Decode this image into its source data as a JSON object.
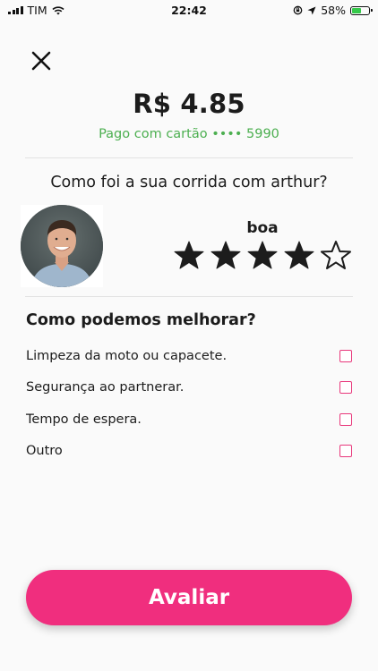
{
  "status_bar": {
    "carrier": "TIM",
    "time": "22:42",
    "battery": "58%",
    "battery_level": 0.58
  },
  "receipt": {
    "price": "R$ 4.85",
    "payment": "Pago com cartão •••• 5990"
  },
  "rating": {
    "question": "Como foi a sua corrida com arthur?",
    "label": "boa",
    "value": 4,
    "max": 5
  },
  "feedback": {
    "title": "Como podemos melhorar?",
    "options": [
      {
        "label": "Limpeza da moto ou capacete.",
        "checked": false
      },
      {
        "label": "Segurança ao partnerar.",
        "checked": false
      },
      {
        "label": "Tempo de espera.",
        "checked": false
      },
      {
        "label": "Outro",
        "checked": false
      }
    ]
  },
  "submit_label": "Avaliar",
  "colors": {
    "accent": "#f02e7e",
    "payment_green": "#4caf50",
    "checkbox_border": "#e8377b"
  }
}
